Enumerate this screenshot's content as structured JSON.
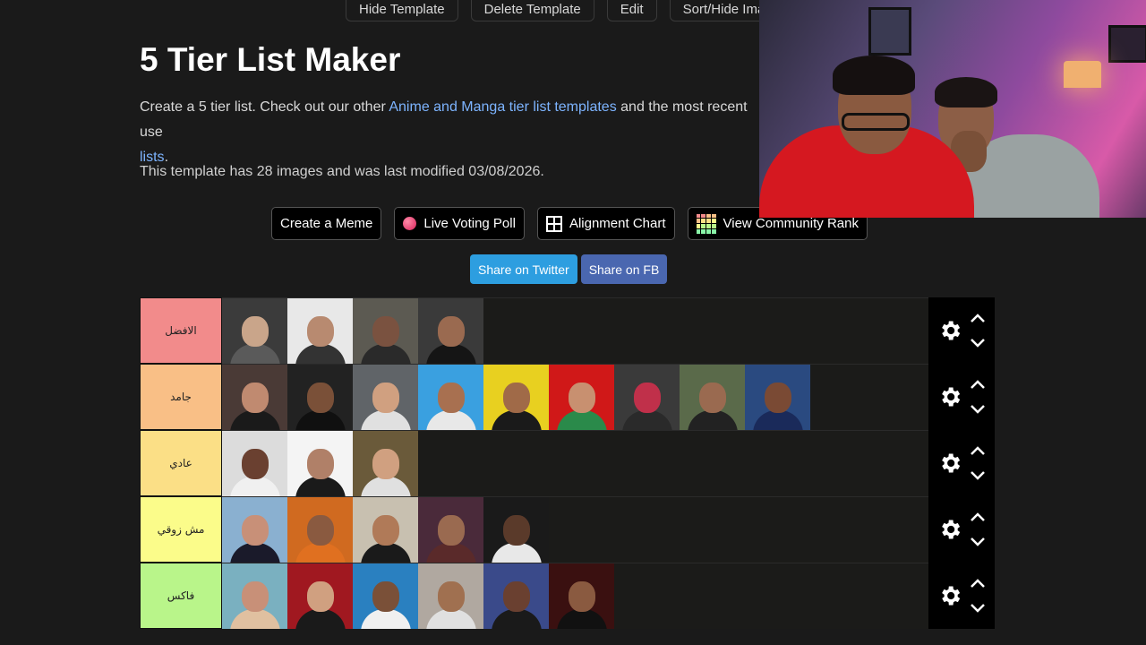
{
  "top_buttons": [
    "Hide Template",
    "Delete Template",
    "Edit",
    "Sort/Hide Imag"
  ],
  "page": {
    "title": "5 Tier List Maker",
    "desc_prefix": "Create a 5 tier list. Check out our other ",
    "desc_link1": "Anime and Manga tier list templates",
    "desc_middle": " and the most recent use",
    "desc_link2": "lists",
    "desc_end": ".",
    "meta": "This template has 28 images and was last modified 03/08/2026."
  },
  "actions": {
    "meme": "Create a Meme",
    "poll": "Live Voting Poll",
    "alignment": "Alignment Chart",
    "community": "View Community Rank"
  },
  "share": {
    "twitter": "Share on Twitter",
    "fb": "Share on FB"
  },
  "colors": {
    "tier_s": "#f28b8b",
    "tier_a": "#f9bf86",
    "tier_b": "#fbdf86",
    "tier_c": "#fbfc8a",
    "tier_d": "#b9f58a",
    "link": "#7db4ff"
  },
  "tiers": [
    {
      "label": "الافضل",
      "color": "#f28b8b",
      "count": 4
    },
    {
      "label": "جامد",
      "color": "#f9bf86",
      "count": 9
    },
    {
      "label": "عادي",
      "color": "#fbdf86",
      "count": 3
    },
    {
      "label": "مش زوقي",
      "color": "#fbfc8a",
      "count": 5
    },
    {
      "label": "فاكس",
      "color": "#b9f58a",
      "count": 6
    }
  ],
  "tier_controls": {
    "settings_icon": "gear-icon",
    "up_icon": "chevron-up-icon",
    "down_icon": "chevron-down-icon"
  },
  "overlay": {
    "type": "webcam-feed"
  }
}
